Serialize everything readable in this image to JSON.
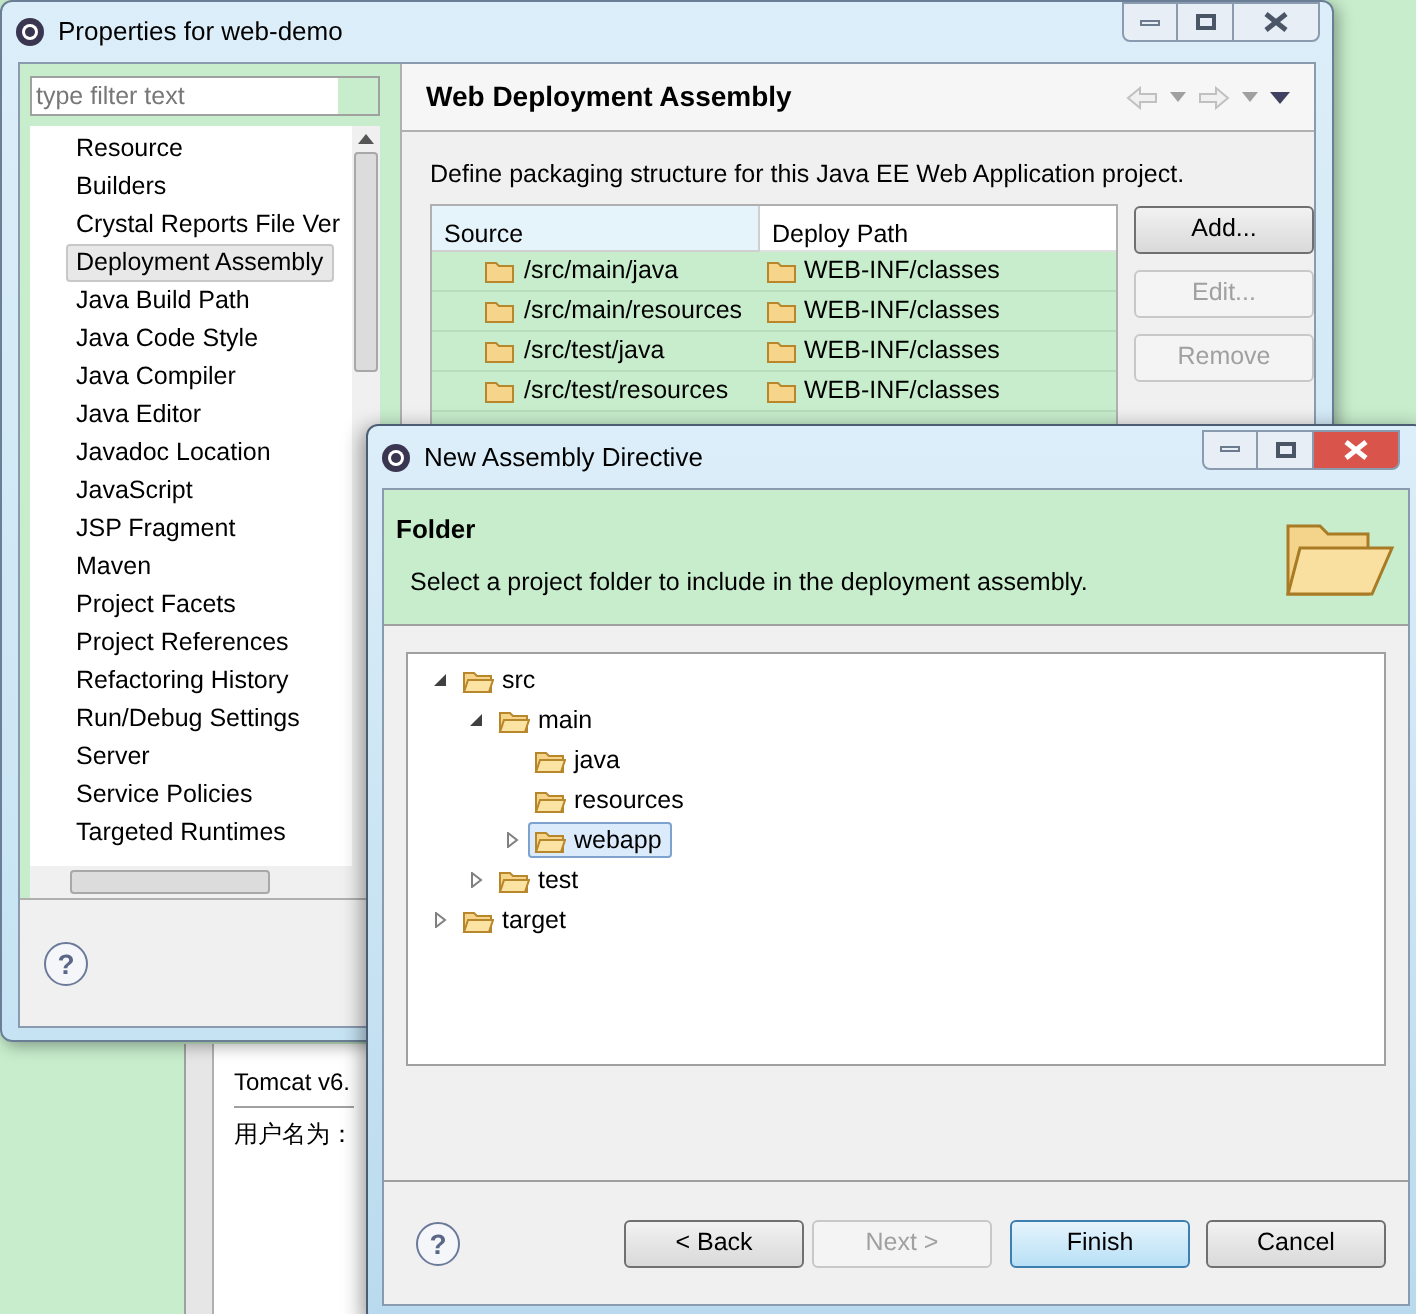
{
  "console": {
    "title": "Tomcat v6.",
    "line": "用户名为："
  },
  "properties_window": {
    "title": "Properties for web-demo",
    "filter": {
      "placeholder": "type filter text"
    },
    "sidebar": {
      "items": [
        {
          "label": "Resource",
          "selected": false
        },
        {
          "label": "Builders",
          "selected": false
        },
        {
          "label": "Crystal Reports File Ver",
          "selected": false
        },
        {
          "label": "Deployment Assembly",
          "selected": true
        },
        {
          "label": "Java Build Path",
          "selected": false
        },
        {
          "label": "Java Code Style",
          "selected": false
        },
        {
          "label": "Java Compiler",
          "selected": false
        },
        {
          "label": "Java Editor",
          "selected": false
        },
        {
          "label": "Javadoc Location",
          "selected": false
        },
        {
          "label": "JavaScript",
          "selected": false
        },
        {
          "label": "JSP Fragment",
          "selected": false
        },
        {
          "label": "Maven",
          "selected": false
        },
        {
          "label": "Project Facets",
          "selected": false
        },
        {
          "label": "Project References",
          "selected": false
        },
        {
          "label": "Refactoring History",
          "selected": false
        },
        {
          "label": "Run/Debug Settings",
          "selected": false
        },
        {
          "label": "Server",
          "selected": false
        },
        {
          "label": "Service Policies",
          "selected": false
        },
        {
          "label": "Targeted Runtimes",
          "selected": false
        }
      ]
    },
    "page_title": "Web Deployment Assembly",
    "description": "Define packaging structure for this Java EE Web Application project.",
    "table": {
      "columns": [
        "Source",
        "Deploy Path"
      ],
      "rows": [
        {
          "source": "/src/main/java",
          "deploy_path": "WEB-INF/classes"
        },
        {
          "source": "/src/main/resources",
          "deploy_path": "WEB-INF/classes"
        },
        {
          "source": "/src/test/java",
          "deploy_path": "WEB-INF/classes"
        },
        {
          "source": "/src/test/resources",
          "deploy_path": "WEB-INF/classes"
        }
      ]
    },
    "buttons": [
      {
        "label": "Add...",
        "disabled": false
      },
      {
        "label": "Edit...",
        "disabled": true
      },
      {
        "label": "Remove",
        "disabled": true
      }
    ],
    "help_icon": "?"
  },
  "dialog": {
    "title": "New Assembly Directive",
    "heading": "Folder",
    "description": "Select a project folder to include in the deployment assembly.",
    "tree": [
      {
        "label": "src",
        "kind": "branch",
        "expanded": true,
        "selected": false,
        "children": [
          {
            "label": "main",
            "kind": "branch",
            "expanded": true,
            "selected": false,
            "children": [
              {
                "label": "java",
                "kind": "leaf",
                "selected": false
              },
              {
                "label": "resources",
                "kind": "leaf",
                "selected": false
              },
              {
                "label": "webapp",
                "kind": "branch",
                "expanded": false,
                "selected": true
              }
            ]
          },
          {
            "label": "test",
            "kind": "branch",
            "expanded": false,
            "selected": false
          }
        ]
      },
      {
        "label": "target",
        "kind": "branch",
        "expanded": false,
        "selected": false
      }
    ],
    "help_icon": "?",
    "buttons": [
      {
        "label": "< Back",
        "disabled": false,
        "default": false
      },
      {
        "label": "Next >",
        "disabled": true,
        "default": false
      },
      {
        "label": "Finish",
        "disabled": false,
        "default": true
      },
      {
        "label": "Cancel",
        "disabled": false,
        "default": false
      }
    ]
  }
}
